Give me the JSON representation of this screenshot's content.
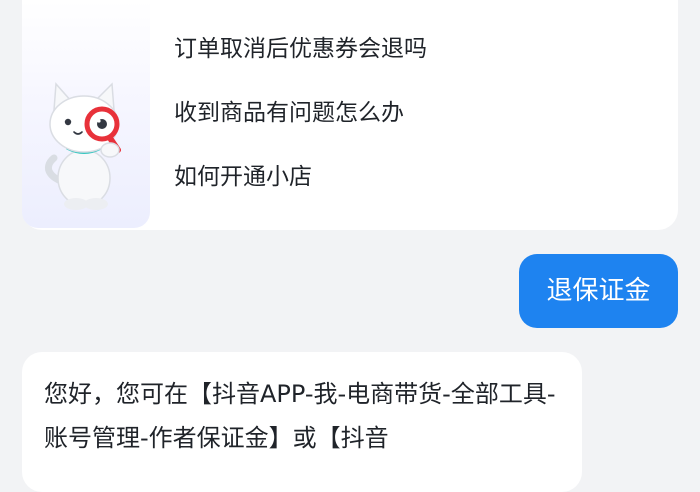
{
  "faq": {
    "items": [
      "订单取消后优惠券会退吗",
      "收到商品有问题怎么办",
      "如何开通小店"
    ]
  },
  "user_message": {
    "text": "退保证金"
  },
  "bot_reply": {
    "text": "您好，您可在【抖音APP-我-电商带货-全部工具-账号管理-作者保证金】或【抖音"
  },
  "colors": {
    "background": "#f2f3f5",
    "user_bubble": "#1e83f0",
    "card": "#ffffff",
    "text": "#1f2329"
  }
}
